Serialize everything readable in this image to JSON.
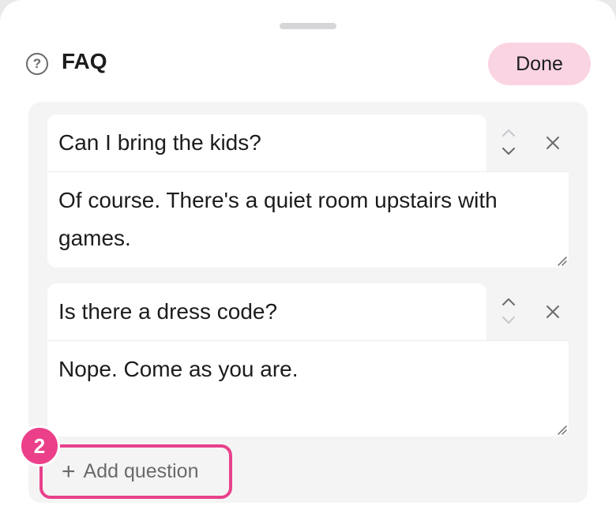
{
  "header": {
    "title": "FAQ",
    "help_icon": "question-circle-icon",
    "done_label": "Done"
  },
  "faq": {
    "items": [
      {
        "question": "Can I bring the kids?",
        "answer": "Of course. There's a quiet room upstairs with games."
      },
      {
        "question": "Is there a dress code?",
        "answer": "Nope. Come as you are."
      }
    ],
    "add_label": "Add question"
  },
  "annotation": {
    "step_number": "2"
  },
  "colors": {
    "accent": "#ec3f8a",
    "done_bg": "#fbd4e3",
    "panel_bg": "#f4f4f5"
  }
}
